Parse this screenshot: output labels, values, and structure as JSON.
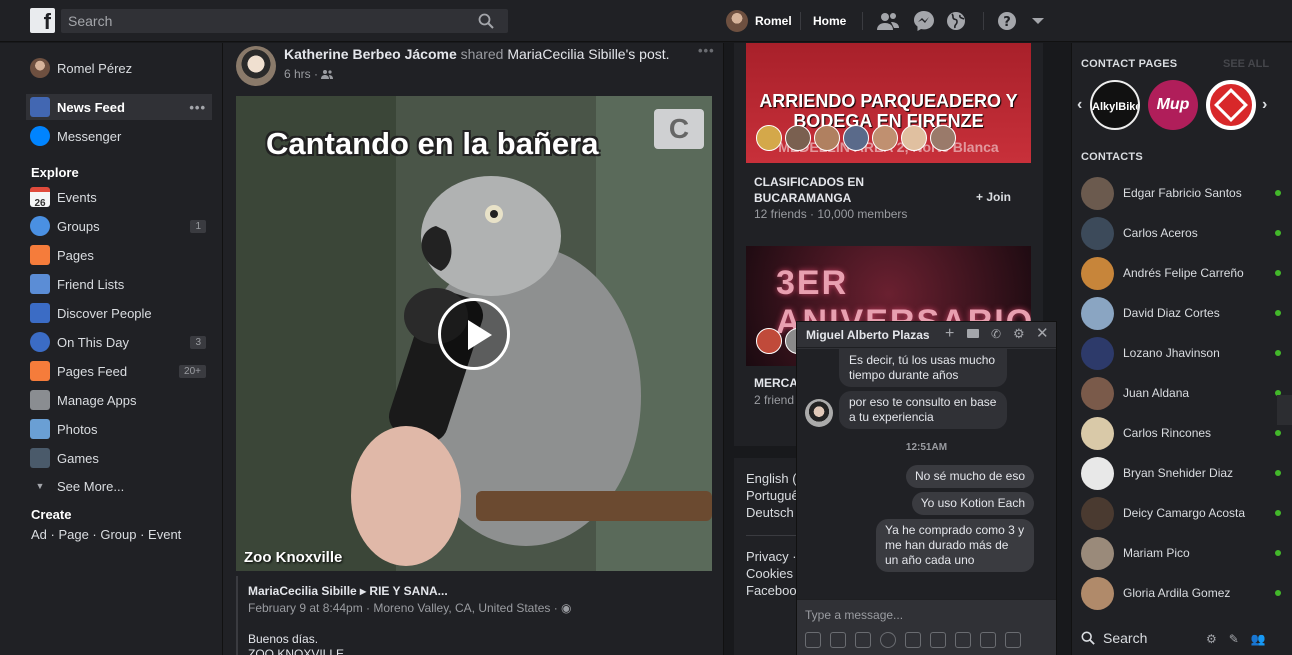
{
  "topbar": {
    "search_placeholder": "Search",
    "user_name": "Romel",
    "home_label": "Home"
  },
  "left": {
    "profile_name": "Romel Pérez",
    "items": [
      {
        "label": "News Feed"
      },
      {
        "label": "Messenger"
      }
    ],
    "explore_title": "Explore",
    "explore": [
      {
        "label": "Events",
        "count": ""
      },
      {
        "label": "Groups",
        "count": "1"
      },
      {
        "label": "Pages",
        "count": ""
      },
      {
        "label": "Friend Lists",
        "count": ""
      },
      {
        "label": "Discover People",
        "count": ""
      },
      {
        "label": "On This Day",
        "count": "3"
      },
      {
        "label": "Pages Feed",
        "count": "20+"
      },
      {
        "label": "Manage Apps",
        "count": ""
      },
      {
        "label": "Photos",
        "count": ""
      },
      {
        "label": "Games",
        "count": ""
      }
    ],
    "see_more": "See More...",
    "create_title": "Create",
    "create_links": "Ad · Page · Group · Event",
    "events_day": "26"
  },
  "post": {
    "author": "Katherine Berbeo Jácome",
    "shared_word": "shared",
    "shared_from": "MariaCecilia Sibille",
    "suffix": "'s post.",
    "time": "6 hrs ·",
    "video_title": "Cantando en la bañera",
    "video_badge": "C",
    "watermark": "Zoo Knoxville",
    "shared_header": "MariaCecilia Sibille ▸ RIE Y SANA...",
    "shared_meta": "February 9 at 8:44pm · Moreno Valley, CA, United States · ",
    "shared_text_1": "Buenos días.",
    "shared_text_2": "ZOO KNOXVILLE"
  },
  "groups": [
    {
      "banner": "ARRIENDO PARQUEADERO Y BODEGA EN FIRENZE",
      "banner_sub": "MEDELLÍN ÁREA 2, Norte Blanca",
      "name": "CLASIFICADOS EN BUCARAMANGA",
      "meta": "12 friends · 10,000 members",
      "join": "+ Join"
    },
    {
      "banner": "3ER ANIVERSARIO",
      "name": "MERCA",
      "meta": "2 friend"
    }
  ],
  "languages": [
    "English (",
    "Portuguê",
    "Deutsch"
  ],
  "footer_links": [
    "Privacy ·",
    "Cookies",
    "Faceboo"
  ],
  "right": {
    "contact_pages_title": "CONTACT PAGES",
    "see_all": "SEE ALL",
    "pages": [
      "AlkylBike",
      "Mup",
      ""
    ],
    "contacts_title": "CONTACTS",
    "contacts": [
      {
        "name": "Edgar Fabricio Santos",
        "color": "#6b5a4e"
      },
      {
        "name": "Carlos Aceros",
        "color": "#3c4a5a"
      },
      {
        "name": "Andrés Felipe Carreño",
        "color": "#c7853a"
      },
      {
        "name": "David Diaz Cortes",
        "color": "#8aa5c2"
      },
      {
        "name": "Lozano Jhavinson",
        "color": "#2d3a6a"
      },
      {
        "name": "Juan Aldana",
        "color": "#7a5a4a"
      },
      {
        "name": "Carlos Rincones",
        "color": "#d9c9a8"
      },
      {
        "name": "Bryan Snehider Diaz",
        "color": "#e8e8e8"
      },
      {
        "name": "Deicy Camargo Acosta",
        "color": "#4a3a30"
      },
      {
        "name": "Mariam Pico",
        "color": "#9a8a7a"
      },
      {
        "name": "Gloria Ardila Gomez",
        "color": "#b08a6a"
      }
    ],
    "search_label": "Search"
  },
  "chat": {
    "title": "Miguel Alberto Plazas",
    "messages_in": [
      "Es decir, tú los usas mucho tiempo durante años",
      "por eso te consulto en base a tu experiencia"
    ],
    "time": "12:51AM",
    "messages_out": [
      "No sé mucho de eso",
      "Yo uso Kotion Each",
      "Ya he comprado como 3 y me han durado más de un año cada uno"
    ],
    "input_placeholder": "Type a message..."
  }
}
